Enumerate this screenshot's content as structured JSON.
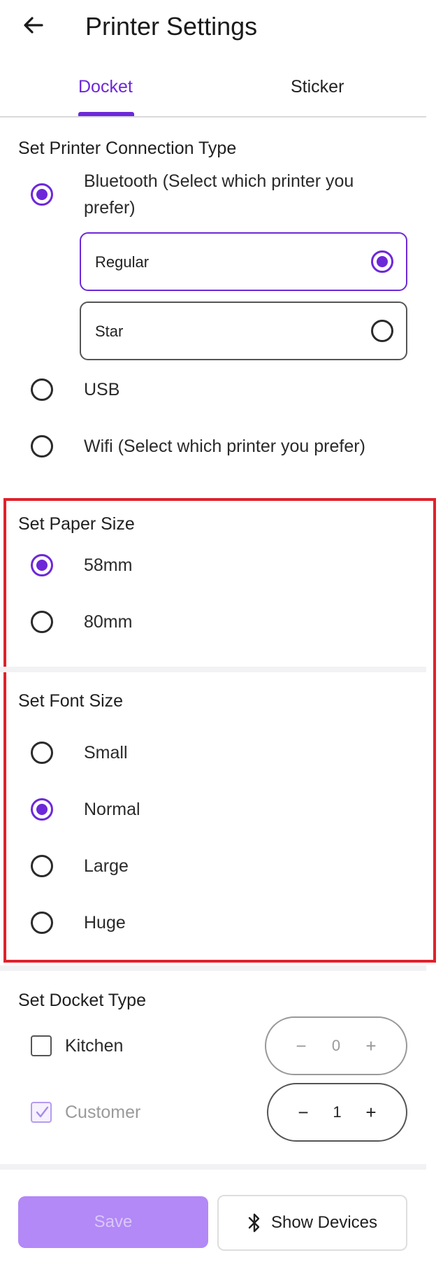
{
  "header": {
    "title": "Printer Settings"
  },
  "tabs": [
    {
      "label": "Docket",
      "active": true
    },
    {
      "label": "Sticker",
      "active": false
    }
  ],
  "connection": {
    "title": "Set Printer Connection Type",
    "options": [
      {
        "label": "Bluetooth (Select which printer you prefer)",
        "selected": true
      },
      {
        "label": "USB",
        "selected": false
      },
      {
        "label": "Wifi (Select which printer you prefer)",
        "selected": false
      }
    ],
    "bluetooth_printers": [
      {
        "label": "Regular",
        "selected": true
      },
      {
        "label": "Star",
        "selected": false
      }
    ]
  },
  "paper_size": {
    "title": "Set Paper Size",
    "options": [
      {
        "label": "58mm",
        "selected": true
      },
      {
        "label": "80mm",
        "selected": false
      }
    ]
  },
  "font_size": {
    "title": "Set Font Size",
    "options": [
      {
        "label": "Small",
        "selected": false
      },
      {
        "label": "Normal",
        "selected": true
      },
      {
        "label": "Large",
        "selected": false
      },
      {
        "label": "Huge",
        "selected": false
      }
    ]
  },
  "docket_type": {
    "title": "Set Docket Type",
    "items": [
      {
        "label": "Kitchen",
        "checked": false,
        "count": "0",
        "minus": "−",
        "plus": "+"
      },
      {
        "label": "Customer",
        "checked": true,
        "count": "1",
        "minus": "−",
        "plus": "+"
      }
    ]
  },
  "footer": {
    "save_label": "Save",
    "devices_label": "Show Devices"
  },
  "colors": {
    "accent": "#6d28d9",
    "highlight_border": "#e0212b",
    "save_bg": "#b388f7"
  }
}
